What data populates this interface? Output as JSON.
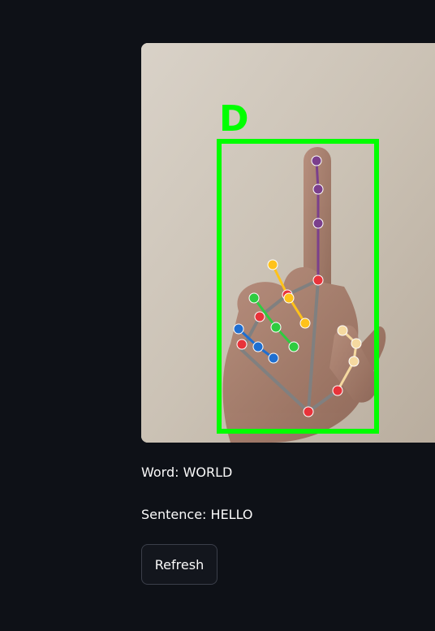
{
  "camera": {
    "detected_letter": "D",
    "box_color": "#00ff00"
  },
  "status": {
    "word_label": "Word:",
    "word_value": "WORLD",
    "sentence_label": "Sentence:",
    "sentence_value": "HELLO"
  },
  "actions": {
    "refresh_label": "Refresh"
  },
  "colors": {
    "background": "#0e1117",
    "text": "#fafafa",
    "button_border": "#3b3f4a",
    "landmark_wrist": "#e8333a",
    "landmark_thumb": "#f5d9a0",
    "landmark_index": "#7b3f8c",
    "landmark_middle": "#ffc21a",
    "landmark_ring": "#2ecc40",
    "landmark_pinky": "#1f6fd1",
    "connection": "#808080"
  }
}
